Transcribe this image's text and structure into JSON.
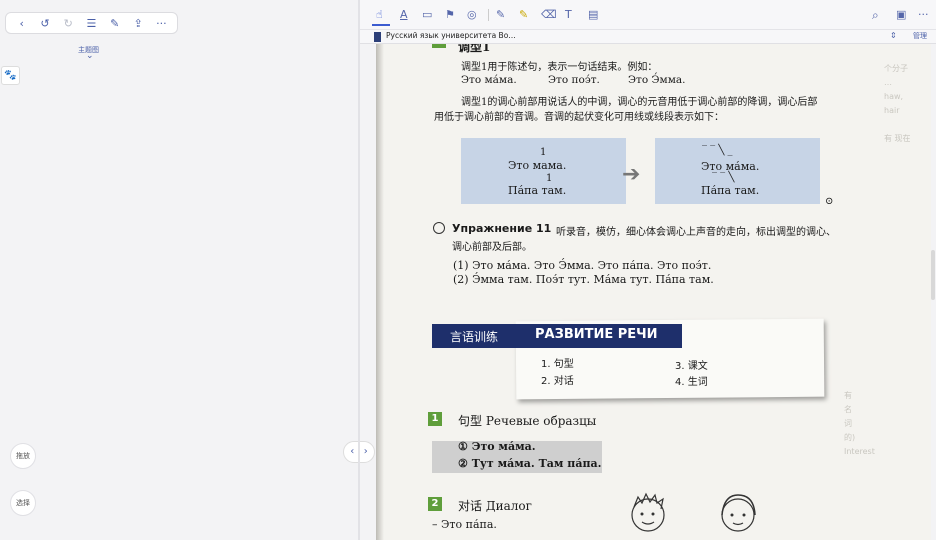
{
  "left_toolbar": {
    "icons": [
      "back-icon",
      "undo-icon",
      "redo-icon",
      "list-icon",
      "edit-icon",
      "share-icon",
      "more-icon"
    ],
    "glyphs": [
      "‹",
      "↺",
      "↻",
      "☰",
      "✎",
      "⇪",
      "···"
    ]
  },
  "left": {
    "theme_label": "主题图",
    "theme_chevron": "⌄",
    "side_icon": "🐾",
    "btn_drag": "拖放",
    "btn_select": "选择",
    "nav_arrows": "‹ · ›"
  },
  "right_toolbar": {
    "tools": [
      "☝",
      "A",
      "▭",
      "⚑",
      "◎",
      "✎",
      "✎",
      "⌫",
      "T",
      "▤"
    ],
    "right_icons": [
      "⌕",
      "▣",
      "···"
    ]
  },
  "tab": {
    "title": "Русский язык университета Во…",
    "manage": "管理",
    "sort": "⇕"
  },
  "page": {
    "heading_partial": "调型1",
    "p1": "调型1用于陈述句，表示一句话结束。例如：",
    "ex": [
      "Это ма́ма.",
      "Это поэ́т.",
      "Это Э́мма."
    ],
    "p2a": "调型1的调心前部用说话人的中调，调心的元音用低于调心前部的降调，调心后部",
    "p2b": "用低于调心前部的音调。音调的起伏变化可用线或线段表示如下：",
    "box1_num": "1",
    "box1_l1": "Это мама.",
    "box1_num2": "1",
    "box1_l2": "Па́па там.",
    "box2_marks": "‾ ‾ ╲ _",
    "box2_l1": "Это ма́ма.",
    "box2_marks2": "‾ ‾ ╲",
    "box2_l2": "Па́па там.",
    "arrow": "➔",
    "ex11_title": "Упражнение 11",
    "ex11_text": "听录音，模仿，细心体会调心上声音的走向，标出调型的调心、",
    "ex11_text2": "调心前部及后部。",
    "ex11_l1": "(1) Это ма́ма. Это Э́мма. Это па́па. Это поэ́т.",
    "ex11_l2": "(2) Э́мма там. Поэ́т тут. Ма́ма тут. Па́па там.",
    "section_cn": "言语训练",
    "section_ru": "РАЗВИТИЕ РЕЧИ",
    "menu": [
      "1. 句型",
      "2. 对话",
      "3. 课文",
      "4. 生词"
    ],
    "s1_num": "1",
    "s1_title": "句型 Речевые образцы",
    "s1_l1": "① Это ма́ма.",
    "s1_l2": "② Тут ма́ма. Там па́па.",
    "s2_num": "2",
    "s2_title": "对话 Диалог",
    "s2_l1": "– Это па́па.",
    "circle_mark": "⊙"
  },
  "colors": {
    "accent": "#4a5fa8",
    "banner": "#1e2f6b",
    "section_green": "#5f9e3b",
    "intonation_box": "#c7d4e6"
  }
}
